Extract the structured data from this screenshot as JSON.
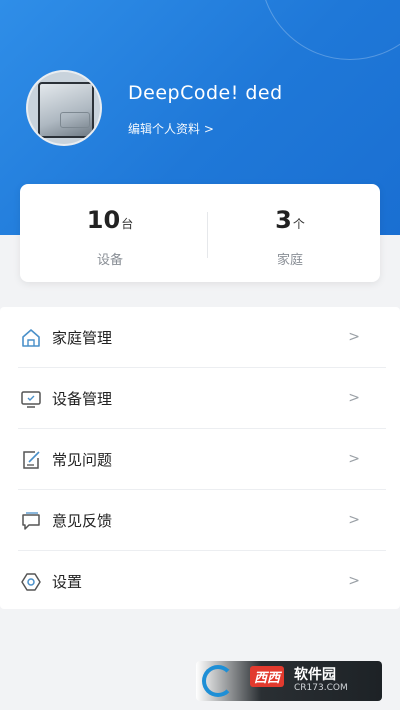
{
  "profile": {
    "username": "DeepCode! ded",
    "edit_link": "编辑个人资料 >"
  },
  "stats": [
    {
      "value": "10",
      "unit": "台",
      "label": "设备"
    },
    {
      "value": "3",
      "unit": "个",
      "label": "家庭"
    }
  ],
  "menu": {
    "items": [
      {
        "label": "家庭管理",
        "icon": "home-icon",
        "chevron": ">"
      },
      {
        "label": "设备管理",
        "icon": "monitor-icon",
        "chevron": ">"
      },
      {
        "label": "常见问题",
        "icon": "edit-note-icon",
        "chevron": ">"
      },
      {
        "label": "意见反馈",
        "icon": "chat-bubble-icon",
        "chevron": ">"
      },
      {
        "label": "设置",
        "icon": "settings-hexagon-icon",
        "chevron": ">"
      }
    ]
  },
  "watermark": {
    "badge": "西西",
    "title": "软件园",
    "subtitle": "CR173.COM"
  },
  "colors": {
    "header_blue": "#2f8ee8",
    "icon_blue": "#4a90c9"
  }
}
